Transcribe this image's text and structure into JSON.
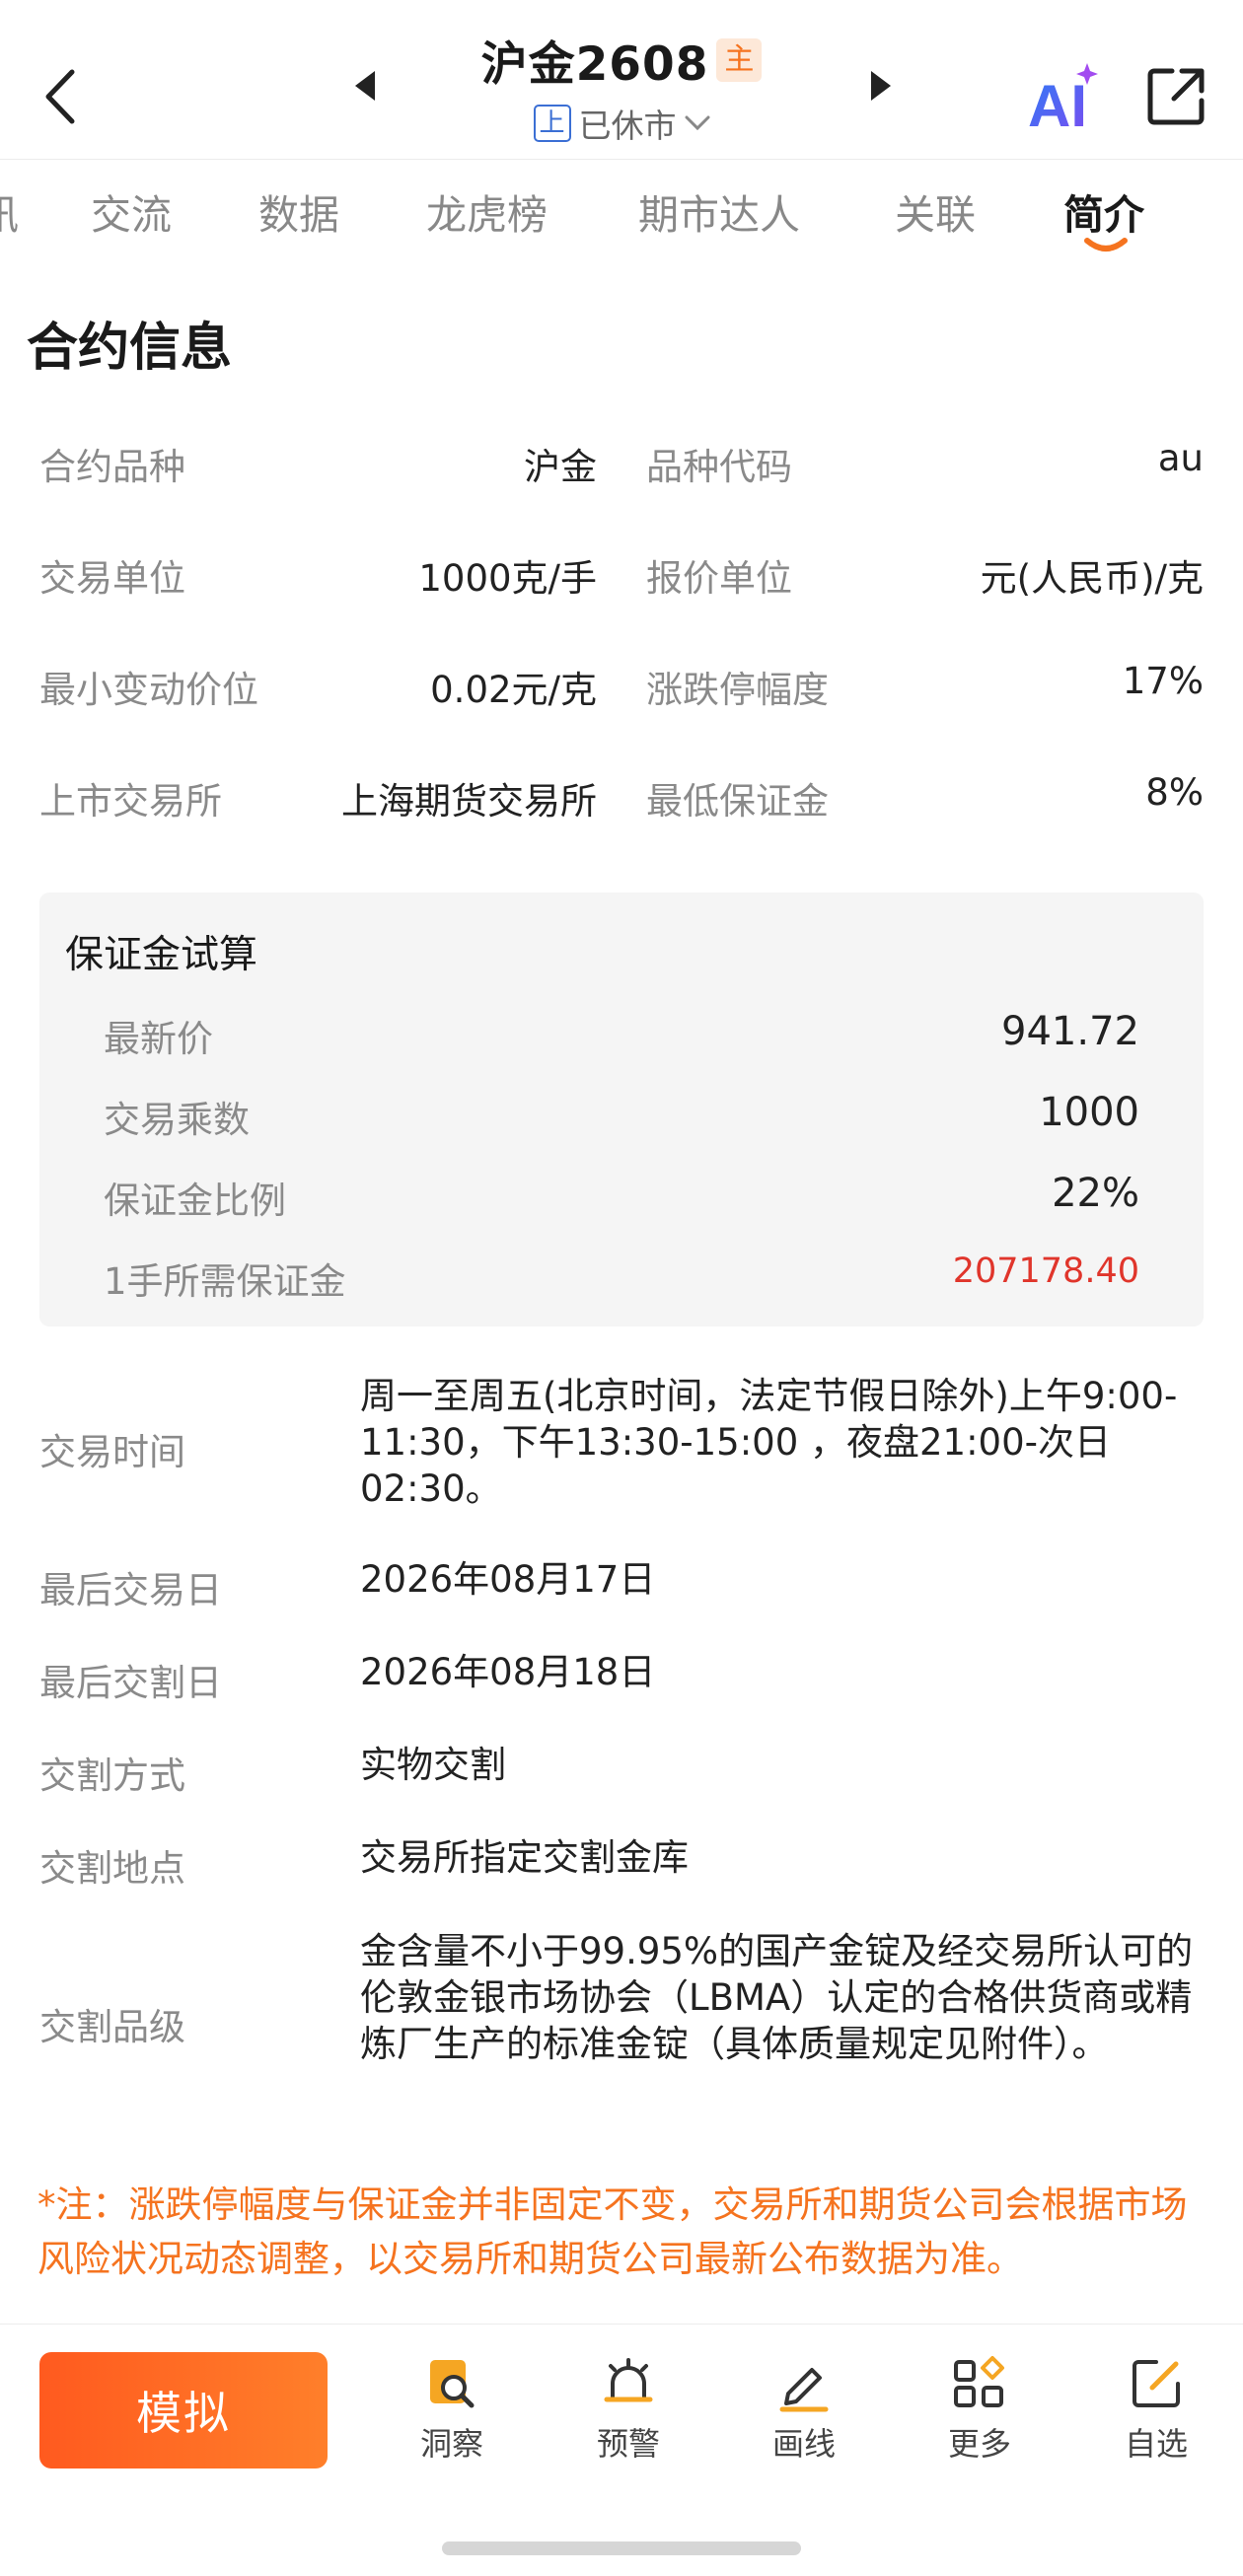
{
  "header": {
    "title": "沪金2608",
    "main_badge": "主",
    "exchange_badge": "上",
    "status": "已休市",
    "ai_label": "AI",
    "colors": {
      "accent": "#f5731f",
      "blue": "#3b6fd4"
    }
  },
  "tabs": [
    {
      "label": "讯",
      "active": false
    },
    {
      "label": "交流",
      "active": false
    },
    {
      "label": "数据",
      "active": false
    },
    {
      "label": "龙虎榜",
      "active": false
    },
    {
      "label": "期市达人",
      "active": false
    },
    {
      "label": "关联",
      "active": false
    },
    {
      "label": "简介",
      "active": true
    }
  ],
  "section_title": "合约信息",
  "info_grid": [
    {
      "l1": "合约品种",
      "v1": "沪金",
      "l2": "品种代码",
      "v2": "au"
    },
    {
      "l1": "交易单位",
      "v1": "1000克/手",
      "l2": "报价单位",
      "v2": "元(人民币)/克"
    },
    {
      "l1": "最小变动价位",
      "v1": "0.02元/克",
      "l2": "涨跌停幅度",
      "v2": "17%"
    },
    {
      "l1": "上市交易所",
      "v1": "上海期货交易所",
      "l2": "最低保证金",
      "v2": "8%"
    }
  ],
  "margin_calc": {
    "title": "保证金试算",
    "rows": [
      {
        "label": "最新价",
        "value": "941.72"
      },
      {
        "label": "交易乘数",
        "value": "1000"
      },
      {
        "label": "保证金比例",
        "value": "22%"
      },
      {
        "label": "1手所需保证金",
        "value": "207178.40"
      }
    ]
  },
  "details": [
    {
      "label": "交易时间",
      "value": "周一至周五(北京时间，法定节假日除外)上午9:00-11:30，下午13:30-15:00 ，夜盘21:00-次日02:30。"
    },
    {
      "label": "最后交易日",
      "value": "2026年08月17日"
    },
    {
      "label": "最后交割日",
      "value": "2026年08月18日"
    },
    {
      "label": "交割方式",
      "value": "实物交割"
    },
    {
      "label": "交割地点",
      "value": "交易所指定交割金库"
    },
    {
      "label": "交割品级",
      "value": "金含量不小于99.95%的国产金锭及经交易所认可的伦敦金银市场协会（LBMA）认定的合格供货商或精炼厂生产的标准金锭（具体质量规定见附件）。"
    }
  ],
  "note": "*注：涨跌停幅度与保证金并非固定不变，交易所和期货公司会根据市场风险状况动态调整，以交易所和期货公司最新公布数据为准。",
  "bottom_bar": {
    "sim_label": "模拟",
    "items": [
      {
        "label": "洞察",
        "icon": "insight-icon"
      },
      {
        "label": "预警",
        "icon": "alarm-icon"
      },
      {
        "label": "画线",
        "icon": "pen-icon"
      },
      {
        "label": "更多",
        "icon": "grid-icon"
      },
      {
        "label": "自选",
        "icon": "edit-icon"
      }
    ]
  }
}
